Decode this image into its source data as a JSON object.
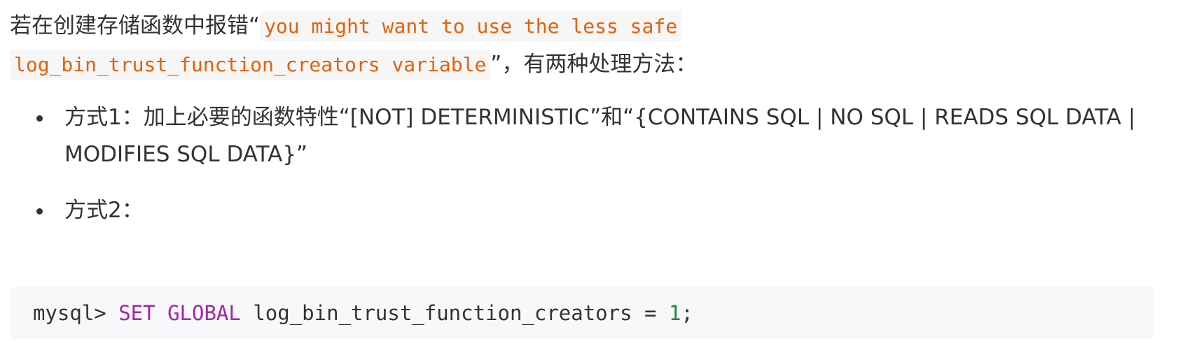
{
  "intro": {
    "prefix": "若在创建存储函数中报错“",
    "code": "you might want to use the less safe log_bin_trust_function_creators variable",
    "suffix": "”，有两种处理方法："
  },
  "list": {
    "items": [
      {
        "text": "方式1：加上必要的函数特性“[NOT] DETERMINISTIC”和“{CONTAINS SQL | NO SQL | READS SQL DATA | MODIFIES SQL DATA}”"
      },
      {
        "text": "方式2："
      }
    ]
  },
  "code_block": {
    "prompt": "mysql> ",
    "keyword_set": "SET",
    "keyword_global": "GLOBAL",
    "variable": "log_bin_trust_function_creators",
    "operator": " = ",
    "value": "1",
    "terminator": ";"
  },
  "colors": {
    "text": "#333333",
    "inline_code": "#e36209",
    "keyword": "#a626a4",
    "number": "#22863a",
    "code_background": "#f6f8fa"
  }
}
